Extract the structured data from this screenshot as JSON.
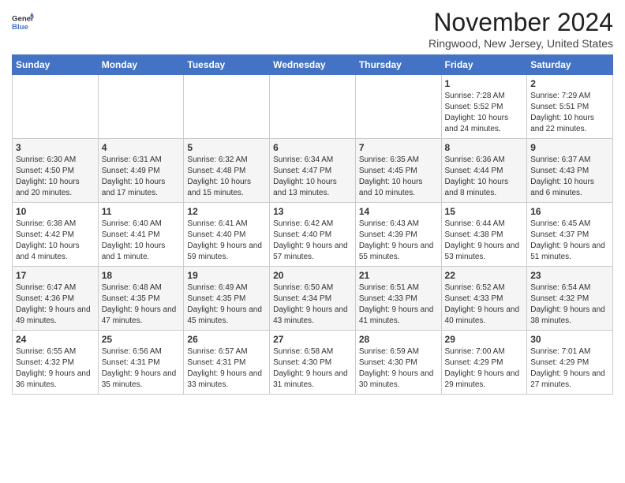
{
  "header": {
    "logo_line1": "General",
    "logo_line2": "Blue",
    "title": "November 2024",
    "location": "Ringwood, New Jersey, United States"
  },
  "weekdays": [
    "Sunday",
    "Monday",
    "Tuesday",
    "Wednesday",
    "Thursday",
    "Friday",
    "Saturday"
  ],
  "weeks": [
    [
      {
        "day": "",
        "info": ""
      },
      {
        "day": "",
        "info": ""
      },
      {
        "day": "",
        "info": ""
      },
      {
        "day": "",
        "info": ""
      },
      {
        "day": "",
        "info": ""
      },
      {
        "day": "1",
        "info": "Sunrise: 7:28 AM\nSunset: 5:52 PM\nDaylight: 10 hours and 24 minutes."
      },
      {
        "day": "2",
        "info": "Sunrise: 7:29 AM\nSunset: 5:51 PM\nDaylight: 10 hours and 22 minutes."
      }
    ],
    [
      {
        "day": "3",
        "info": "Sunrise: 6:30 AM\nSunset: 4:50 PM\nDaylight: 10 hours and 20 minutes."
      },
      {
        "day": "4",
        "info": "Sunrise: 6:31 AM\nSunset: 4:49 PM\nDaylight: 10 hours and 17 minutes."
      },
      {
        "day": "5",
        "info": "Sunrise: 6:32 AM\nSunset: 4:48 PM\nDaylight: 10 hours and 15 minutes."
      },
      {
        "day": "6",
        "info": "Sunrise: 6:34 AM\nSunset: 4:47 PM\nDaylight: 10 hours and 13 minutes."
      },
      {
        "day": "7",
        "info": "Sunrise: 6:35 AM\nSunset: 4:45 PM\nDaylight: 10 hours and 10 minutes."
      },
      {
        "day": "8",
        "info": "Sunrise: 6:36 AM\nSunset: 4:44 PM\nDaylight: 10 hours and 8 minutes."
      },
      {
        "day": "9",
        "info": "Sunrise: 6:37 AM\nSunset: 4:43 PM\nDaylight: 10 hours and 6 minutes."
      }
    ],
    [
      {
        "day": "10",
        "info": "Sunrise: 6:38 AM\nSunset: 4:42 PM\nDaylight: 10 hours and 4 minutes."
      },
      {
        "day": "11",
        "info": "Sunrise: 6:40 AM\nSunset: 4:41 PM\nDaylight: 10 hours and 1 minute."
      },
      {
        "day": "12",
        "info": "Sunrise: 6:41 AM\nSunset: 4:40 PM\nDaylight: 9 hours and 59 minutes."
      },
      {
        "day": "13",
        "info": "Sunrise: 6:42 AM\nSunset: 4:40 PM\nDaylight: 9 hours and 57 minutes."
      },
      {
        "day": "14",
        "info": "Sunrise: 6:43 AM\nSunset: 4:39 PM\nDaylight: 9 hours and 55 minutes."
      },
      {
        "day": "15",
        "info": "Sunrise: 6:44 AM\nSunset: 4:38 PM\nDaylight: 9 hours and 53 minutes."
      },
      {
        "day": "16",
        "info": "Sunrise: 6:45 AM\nSunset: 4:37 PM\nDaylight: 9 hours and 51 minutes."
      }
    ],
    [
      {
        "day": "17",
        "info": "Sunrise: 6:47 AM\nSunset: 4:36 PM\nDaylight: 9 hours and 49 minutes."
      },
      {
        "day": "18",
        "info": "Sunrise: 6:48 AM\nSunset: 4:35 PM\nDaylight: 9 hours and 47 minutes."
      },
      {
        "day": "19",
        "info": "Sunrise: 6:49 AM\nSunset: 4:35 PM\nDaylight: 9 hours and 45 minutes."
      },
      {
        "day": "20",
        "info": "Sunrise: 6:50 AM\nSunset: 4:34 PM\nDaylight: 9 hours and 43 minutes."
      },
      {
        "day": "21",
        "info": "Sunrise: 6:51 AM\nSunset: 4:33 PM\nDaylight: 9 hours and 41 minutes."
      },
      {
        "day": "22",
        "info": "Sunrise: 6:52 AM\nSunset: 4:33 PM\nDaylight: 9 hours and 40 minutes."
      },
      {
        "day": "23",
        "info": "Sunrise: 6:54 AM\nSunset: 4:32 PM\nDaylight: 9 hours and 38 minutes."
      }
    ],
    [
      {
        "day": "24",
        "info": "Sunrise: 6:55 AM\nSunset: 4:32 PM\nDaylight: 9 hours and 36 minutes."
      },
      {
        "day": "25",
        "info": "Sunrise: 6:56 AM\nSunset: 4:31 PM\nDaylight: 9 hours and 35 minutes."
      },
      {
        "day": "26",
        "info": "Sunrise: 6:57 AM\nSunset: 4:31 PM\nDaylight: 9 hours and 33 minutes."
      },
      {
        "day": "27",
        "info": "Sunrise: 6:58 AM\nSunset: 4:30 PM\nDaylight: 9 hours and 31 minutes."
      },
      {
        "day": "28",
        "info": "Sunrise: 6:59 AM\nSunset: 4:30 PM\nDaylight: 9 hours and 30 minutes."
      },
      {
        "day": "29",
        "info": "Sunrise: 7:00 AM\nSunset: 4:29 PM\nDaylight: 9 hours and 29 minutes."
      },
      {
        "day": "30",
        "info": "Sunrise: 7:01 AM\nSunset: 4:29 PM\nDaylight: 9 hours and 27 minutes."
      }
    ]
  ]
}
